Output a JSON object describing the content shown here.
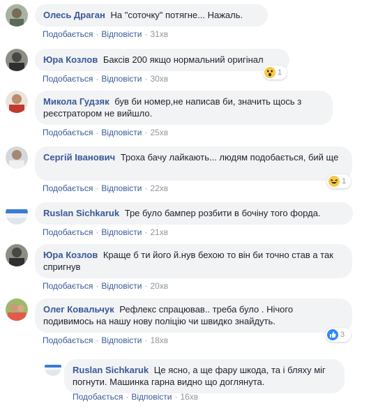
{
  "actions": {
    "like": "Подобається",
    "reply": "Відповісти",
    "sep": "·"
  },
  "comments": [
    {
      "author": "Олесь Драган",
      "text": "На \"соточку\" потягне... Нажаль.",
      "time": "31хв"
    },
    {
      "author": "Юра Козлов",
      "text": "Баксів 200 якщо нормальний оригінал",
      "time": "30хв",
      "reaction": {
        "type": "wow",
        "count": "1"
      }
    },
    {
      "author": "Микола Гудзяк",
      "text": "був би номер,не написав би, значить щось з реєстратором не вийшло.",
      "time": "25хв"
    },
    {
      "author": "Сергій Іванович",
      "text": "Троха бачу лайкають... людям подобається, бий ще",
      "time": "22хв",
      "reaction": {
        "type": "haha",
        "count": "1"
      }
    },
    {
      "author": "Ruslan Sichkaruk",
      "text": "Тре було бампер розбити в бочіну того форда.",
      "time": "21хв"
    },
    {
      "author": "Юра Козлов",
      "text": "Краще б ти його й.нув бехою то він би точно став а так спригнув",
      "time": "20хв"
    },
    {
      "author": "Олег Ковальчук",
      "text": "Рефлекс спрацював.. треба було . Нічого подивимось на нашу нову поліцію чи швидко знайдуть.",
      "time": "18хв",
      "reaction": {
        "type": "like",
        "count": "3"
      }
    },
    {
      "author": "Ruslan Sichkaruk",
      "text": "Це ясно, а ще фару шкода, та і бляху міг погнути. Машинка гарна видно що доглянута.",
      "time": "16хв"
    }
  ],
  "colors": {
    "link": "#385898",
    "bubble": "#f2f3f5",
    "meta": "#90949c",
    "text": "#1d2129"
  }
}
